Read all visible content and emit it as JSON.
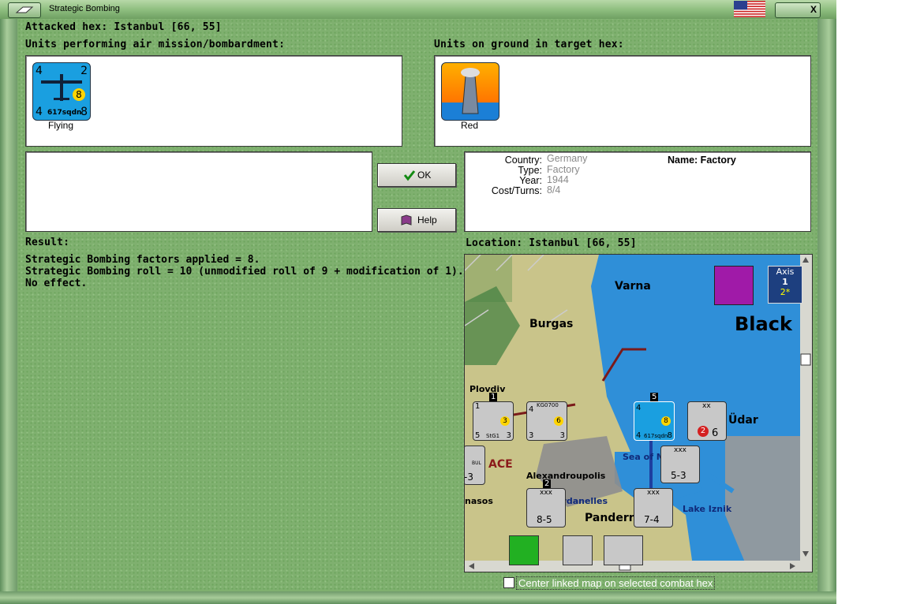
{
  "window": {
    "title": "Strategic Bombing",
    "close_glyph": "X"
  },
  "attacked_hex": "Attacked hex: Istanbul  [66, 55]",
  "air_units": {
    "label": "Units performing air mission/bombardment:",
    "units": [
      {
        "caption": "Flying",
        "top_left": "4",
        "top_right": "2",
        "bottom_left": "4",
        "bottom_right": "8",
        "badge": "8",
        "name": "617sqdn"
      }
    ]
  },
  "ground_units": {
    "label": "Units on ground in target hex:",
    "units": [
      {
        "caption": "Red"
      }
    ]
  },
  "buttons": {
    "ok": "OK",
    "help": "Help"
  },
  "target_info": {
    "country_label": "Country:",
    "country": "Germany",
    "type_label": "Type:",
    "type": "Factory",
    "year_label": "Year:",
    "year": "1944",
    "cost_label": "Cost/Turns:",
    "cost": "8/4",
    "name": "Name: Factory"
  },
  "result": {
    "label": "Result:",
    "lines": [
      "Strategic Bombing factors applied = 8.",
      "Strategic Bombing roll = 10 (unmodified roll of 9 + modification of 1).",
      "No effect."
    ]
  },
  "location": "Location:  Istanbul  [66, 55]",
  "map": {
    "places": [
      "Varna",
      "Burgas",
      "Black",
      "Plovdiv",
      "Alexandroupolis",
      "Sea of M",
      "Üdar",
      "ardanelles",
      "Pandern",
      "Lake Iznik",
      "ACE",
      "nasos"
    ],
    "axis_box": {
      "title": "Axis",
      "value": "1",
      "sub": "2*"
    },
    "counters": [
      {
        "top": "1",
        "tl": "1",
        "bl": "5",
        "br": "3",
        "badge": "3",
        "name": "StG1"
      },
      {
        "top": "",
        "tl": "4",
        "bl": "3",
        "br": "3",
        "badge": "6",
        "name": "KG0700"
      },
      {
        "top": "5",
        "tl": "4",
        "bl": "4",
        "br": "8",
        "badge": "8",
        "name": "617sqdn"
      },
      {
        "top": "",
        "tl": "xx",
        "bl": "",
        "br": "6",
        "badge": "2",
        "name": ""
      },
      {
        "top": "",
        "tl": "xxx",
        "bl": "5-3",
        "br": "",
        "badge": "",
        "name": ""
      },
      {
        "top": "2",
        "tl": "xxx",
        "bl": "8-5",
        "br": "",
        "badge": "",
        "name": ""
      },
      {
        "top": "",
        "tl": "xxx",
        "bl": "7-4",
        "br": "",
        "badge": "",
        "name": ""
      },
      {
        "top": "",
        "tl": "",
        "bl": "-3",
        "br": "",
        "badge": "",
        "name": "BUL"
      }
    ]
  },
  "center_checkbox": {
    "label": "Center linked map on selected combat hex",
    "checked": false
  },
  "colors": {
    "background": "#7fb06f",
    "accent": "#0a5a0a",
    "friendly_air": "#1a9fe0",
    "unit_badge": "#ffd400"
  }
}
